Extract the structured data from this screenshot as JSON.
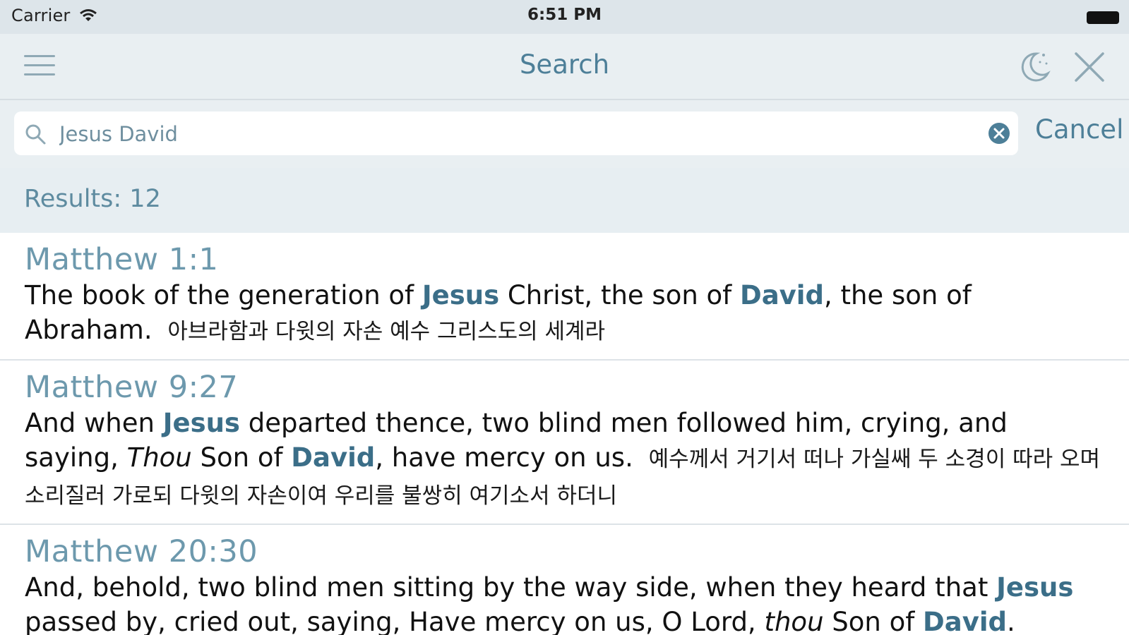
{
  "status_bar": {
    "carrier": "Carrier",
    "time": "6:51 PM",
    "icons": [
      "wifi-icon",
      "battery-icon"
    ]
  },
  "nav": {
    "title": "Search",
    "icons": [
      "menu-icon",
      "night-mode-icon",
      "close-icon"
    ]
  },
  "search": {
    "value": "Jesus David",
    "cancel_label": "Cancel",
    "icons": [
      "search-icon",
      "clear-icon"
    ]
  },
  "results": {
    "label": "Results: 12",
    "items": [
      {
        "ref": "Matthew 1:1",
        "segments": [
          {
            "text": "The book of the generation of "
          },
          {
            "text": "Jesus",
            "style": "hl"
          },
          {
            "text": " Christ, the son of "
          },
          {
            "text": "David",
            "style": "hl"
          },
          {
            "text": ", the son of Abraham."
          },
          {
            "text": "아브라함과 다윗의 자손 예수 그리스도의 세계라",
            "style": "ko"
          }
        ]
      },
      {
        "ref": "Matthew 9:27",
        "segments": [
          {
            "text": "And when "
          },
          {
            "text": "Jesus",
            "style": "hl"
          },
          {
            "text": " departed thence, two blind men followed him, crying, and saying, "
          },
          {
            "text": "Thou",
            "style": "it"
          },
          {
            "text": " Son of "
          },
          {
            "text": "David",
            "style": "hl"
          },
          {
            "text": ", have mercy on us."
          },
          {
            "text": "예수께서 거기서 떠나 가실쌔 두 소경이 따라 오며 소리질러 가로되 다윗의 자손이여 우리를 불쌍히 여기소서 하더니",
            "style": "ko"
          }
        ]
      },
      {
        "ref": "Matthew 20:30",
        "segments": [
          {
            "text": "And, behold, two blind men sitting by the way side, when they heard that "
          },
          {
            "text": "Jesus",
            "style": "hl"
          },
          {
            "text": " passed by, cried out, saying, Have mercy on us, O Lord, "
          },
          {
            "text": "thou",
            "style": "it"
          },
          {
            "text": " Son of "
          },
          {
            "text": "David",
            "style": "hl"
          },
          {
            "text": "."
          }
        ]
      }
    ]
  },
  "colors": {
    "accent": "#4d7f98",
    "highlight": "#3b6e88",
    "bar_background": "#e9eff2"
  }
}
